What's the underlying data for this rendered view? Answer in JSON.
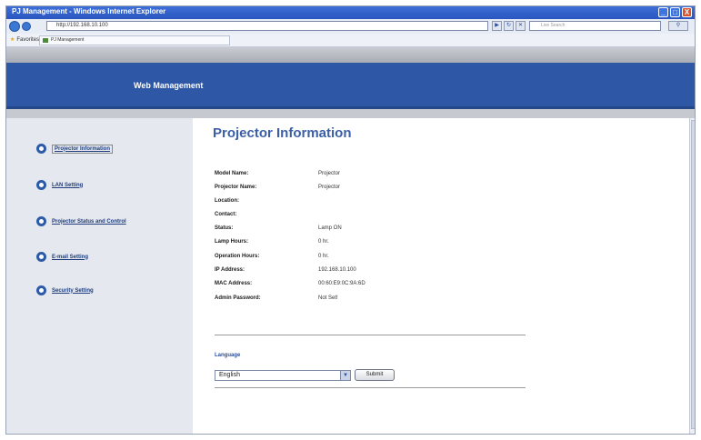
{
  "window": {
    "title": "PJ Management - Windows Internet Explorer",
    "controls": [
      "_",
      "□",
      "X"
    ]
  },
  "address_bar": {
    "url": "http://192.168.10.100",
    "search_placeholder": "Live Search"
  },
  "favorites": {
    "label": "Favorites",
    "tab_title": "PJ Management"
  },
  "header": {
    "title": "Web Management"
  },
  "sidebar": {
    "items": [
      {
        "label": "Projector Information"
      },
      {
        "label": "LAN Setting"
      },
      {
        "label": "Projector Status and Control"
      },
      {
        "label": "E-mail Setting"
      },
      {
        "label": "Security Setting"
      }
    ]
  },
  "main": {
    "title": "Projector Information",
    "info": [
      {
        "label": "Model Name:",
        "value": "Projector"
      },
      {
        "label": "Projector Name:",
        "value": "Projector"
      },
      {
        "label": "Location:",
        "value": ""
      },
      {
        "label": "Contact:",
        "value": ""
      },
      {
        "label": "Status:",
        "value": "Lamp ON"
      },
      {
        "label": "Lamp Hours:",
        "value": "0 hr."
      },
      {
        "label": "Operation Hours:",
        "value": "0 hr."
      },
      {
        "label": "IP Address:",
        "value": "192.168.10.100"
      },
      {
        "label": "MAC Address:",
        "value": "00:60:E9:0C:9A:6D"
      },
      {
        "label": "Admin Password:",
        "value": "Not Set!"
      }
    ],
    "language_label": "Language",
    "language_selected": "English",
    "submit_label": "Submit"
  },
  "colors": {
    "header_blue": "#2e57a6",
    "title_blue": "#3a5fa8",
    "sidebar_bg": "#e5e8ee"
  }
}
